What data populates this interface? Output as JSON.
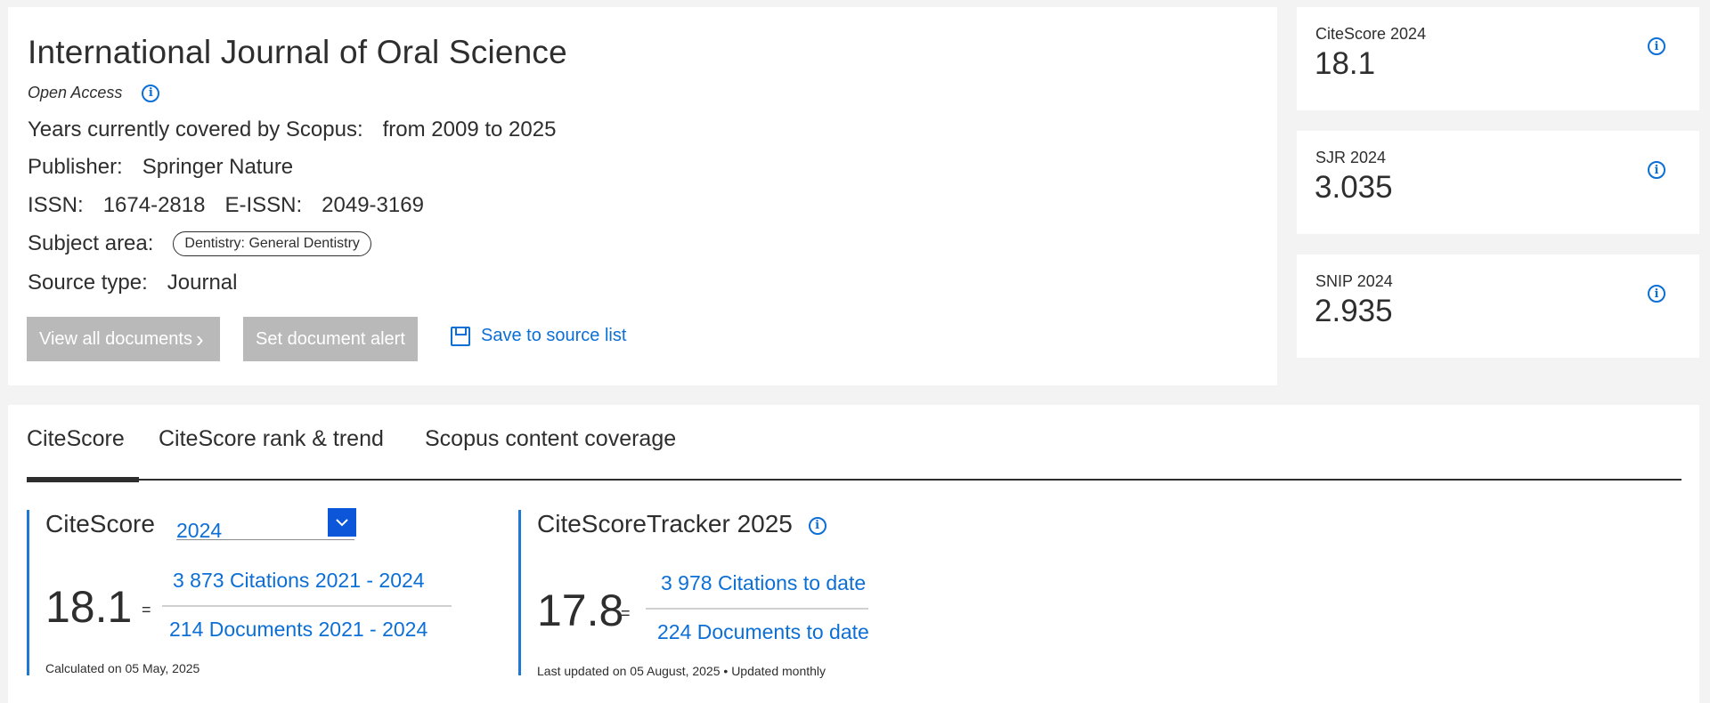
{
  "journal": {
    "title": "International Journal of Oral Science",
    "open_access": "Open Access",
    "years_label": "Years currently covered by Scopus:",
    "years_value": "from 2009 to 2025",
    "publisher_label": "Publisher:",
    "publisher_value": "Springer Nature",
    "issn_label": "ISSN:",
    "issn_value": "1674-2818",
    "eissn_label": "E-ISSN:",
    "eissn_value": "2049-3169",
    "subject_label": "Subject area:",
    "subject_value": "Dentistry: General Dentistry",
    "source_type_label": "Source type:",
    "source_type_value": "Journal"
  },
  "actions": {
    "view_all": "View all documents",
    "view_all_chevron": "›",
    "set_alert": "Set document alert",
    "save_to_list": "Save to source list"
  },
  "metrics": [
    {
      "label": "CiteScore 2024",
      "value": "18.1"
    },
    {
      "label": "SJR 2024",
      "value": "3.035"
    },
    {
      "label": "SNIP 2024",
      "value": "2.935"
    }
  ],
  "tabs": [
    {
      "label": "CiteScore",
      "active": true
    },
    {
      "label": "CiteScore rank & trend",
      "active": false
    },
    {
      "label": "Scopus content coverage",
      "active": false
    }
  ],
  "citescore": {
    "title": "CiteScore",
    "year": "2024",
    "value": "18.1",
    "equals": "=",
    "numerator": "3 873 Citations 2021 - 2024",
    "denominator": "214 Documents 2021 - 2024",
    "footnote": "Calculated on 05 May, 2025"
  },
  "tracker": {
    "title": "CiteScoreTracker 2025",
    "value": "17.8",
    "equals": "=",
    "numerator": "3 978 Citations to date",
    "denominator": "224 Documents to date",
    "footnote": "Last updated on 05 August, 2025 • Updated monthly"
  },
  "icons": {
    "info": "info-icon",
    "save": "save-icon",
    "dropdown": "chevron-down-icon"
  },
  "colors": {
    "accent": "#0c6fd6",
    "button_grey": "#b9b9b9",
    "dropdown_bg": "#0c56d9",
    "block_border": "#1f78d1"
  }
}
